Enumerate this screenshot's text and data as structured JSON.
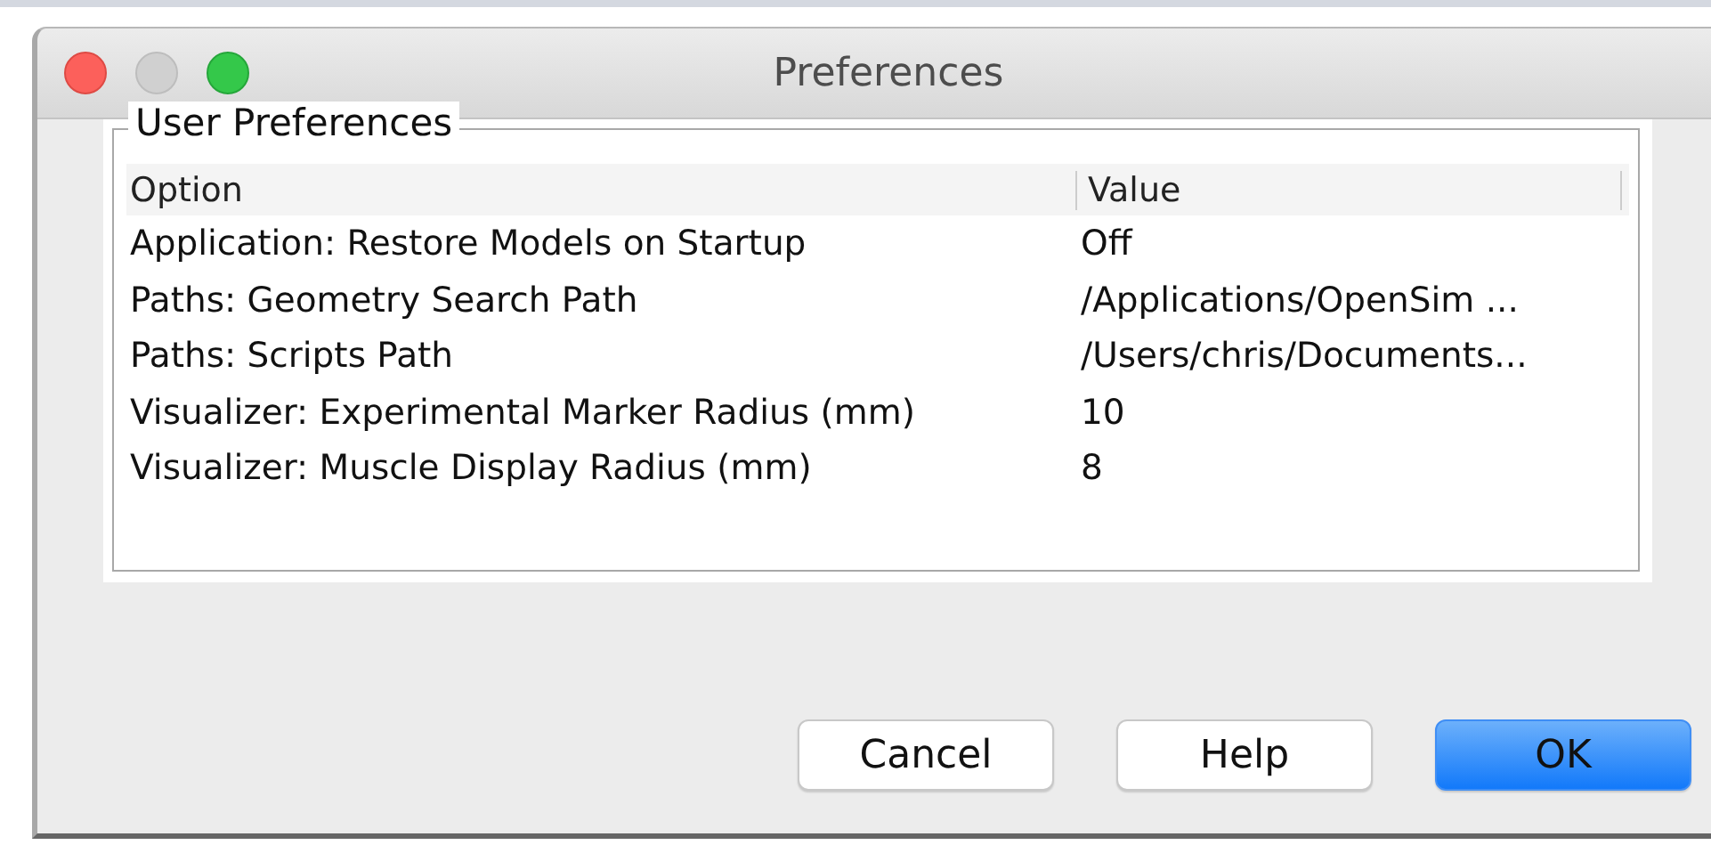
{
  "window": {
    "title": "Preferences"
  },
  "group": {
    "title": "User Preferences"
  },
  "table": {
    "columns": [
      "Option",
      "Value"
    ],
    "rows": [
      {
        "option": "Application: Restore Models on Startup",
        "value": "Off"
      },
      {
        "option": "Paths: Geometry Search Path",
        "value": "/Applications/OpenSim ..."
      },
      {
        "option": "Paths: Scripts Path",
        "value": "/Users/chris/Documents..."
      },
      {
        "option": "Visualizer: Experimental Marker Radius (mm)",
        "value": "10"
      },
      {
        "option": "Visualizer: Muscle Display Radius (mm)",
        "value": "8"
      }
    ]
  },
  "buttons": [
    {
      "label": "Cancel",
      "kind": "normal"
    },
    {
      "label": "Help",
      "kind": "normal"
    },
    {
      "label": "OK",
      "kind": "default"
    }
  ]
}
